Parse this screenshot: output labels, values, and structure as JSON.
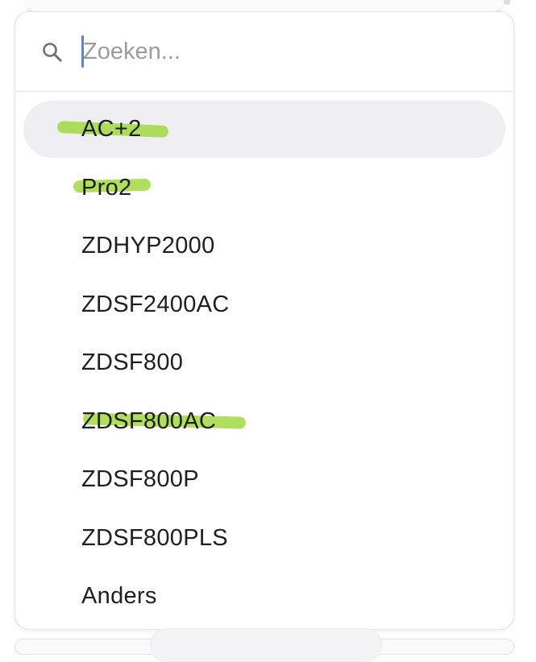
{
  "search": {
    "placeholder": "Zoeken...",
    "value": ""
  },
  "options": [
    {
      "label": "AC+2",
      "active": true,
      "highlighted": true
    },
    {
      "label": "Pro2",
      "active": false,
      "highlighted": true
    },
    {
      "label": "ZDHYP2000",
      "active": false,
      "highlighted": false
    },
    {
      "label": "ZDSF2400AC",
      "active": false,
      "highlighted": false
    },
    {
      "label": "ZDSF800",
      "active": false,
      "highlighted": false
    },
    {
      "label": "ZDSF800AC",
      "active": false,
      "highlighted": true
    },
    {
      "label": "ZDSF800P",
      "active": false,
      "highlighted": false
    },
    {
      "label": "ZDSF800PLS",
      "active": false,
      "highlighted": false
    },
    {
      "label": "Anders",
      "active": false,
      "highlighted": false
    }
  ],
  "colors": {
    "highlight_marker": "#9fd83c",
    "active_row_bg": "#eeeef3",
    "caret": "#4a84f0",
    "text": "#1f1f1f",
    "placeholder": "#9a9aa0"
  },
  "icons": {
    "search": "search-icon"
  }
}
